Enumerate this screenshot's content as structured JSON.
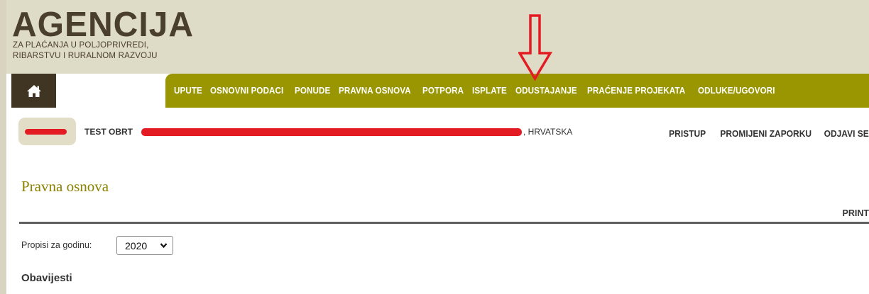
{
  "header": {
    "logo_title": "AGENCIJA",
    "logo_sub_line1": "ZA PLAĆANJA U POLJOPRIVREDI,",
    "logo_sub_line2": "RIBARSTVU I RURALNOM RAZVOJU"
  },
  "nav": {
    "home_icon": "home-icon",
    "items": [
      "UPUTE",
      "OSNOVNI PODACI",
      "PONUDE",
      "PRAVNA OSNOVA",
      "POTPORA",
      "ISPLATE",
      "ODUSTAJANJE",
      "PRAĆENJE PROJEKATA",
      "ODLUKE/UGOVORI"
    ]
  },
  "annotation": {
    "arrow_color": "#e31b23",
    "arrow_icon": "down-arrow-icon"
  },
  "user": {
    "name": "TEST OBRT",
    "country": ", HRVATSKA",
    "redaction_color": "#e31b23"
  },
  "top_links": [
    "PRISTUP",
    "PROMIJENI ZAPORKU",
    "ODJAVI SE"
  ],
  "page": {
    "title": "Pravna osnova",
    "print_label": "PRINT",
    "year_label": "Propisi za godinu:",
    "year_value": "2020",
    "notices_heading": "Obavijesti"
  },
  "colors": {
    "header_bg": "#dedbc6",
    "nav_bg": "#9a9601",
    "home_bg": "#3f3522",
    "title_color": "#8c8100",
    "logo_color": "#4a3f2d"
  }
}
